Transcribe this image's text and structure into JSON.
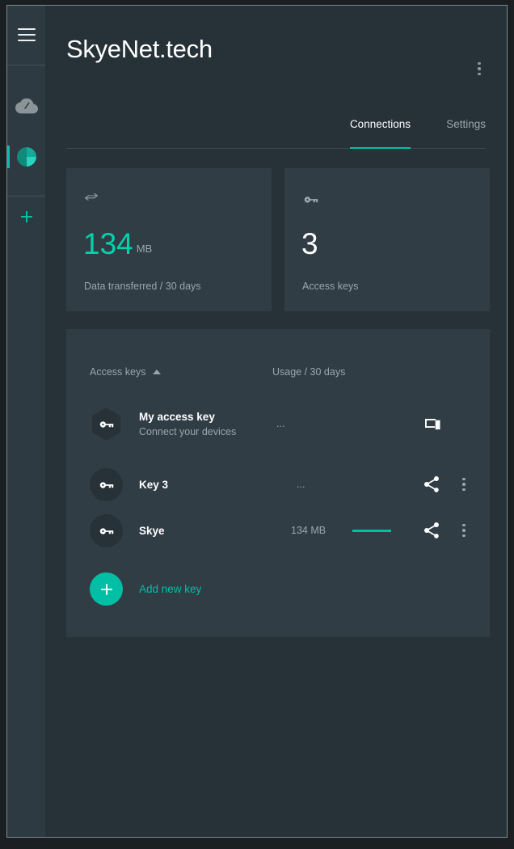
{
  "sidebar": {
    "menu_icon": "hamburger-menu-icon",
    "items": [
      {
        "icon": "cloud-slash-icon",
        "label": "",
        "selected": false,
        "color": "#8a9499"
      },
      {
        "icon": "teal-pie-circle-icon",
        "label": "",
        "selected": true,
        "color": "#00bfa5"
      },
      {
        "icon": "plus-icon",
        "label": "",
        "selected": false,
        "color": "#00bfa5"
      }
    ]
  },
  "header": {
    "title": "SkyeNet.tech",
    "overflow_menu_icon": "more-vert-icon"
  },
  "tabs": [
    {
      "label": "Connections",
      "active": true
    },
    {
      "label": "Settings",
      "active": false
    }
  ],
  "stats": [
    {
      "icon": "transfer-arrows-icon",
      "value": "134",
      "unit": "MB",
      "label": "Data transferred / 30 days",
      "value_color": "#00d3ac"
    },
    {
      "icon": "key-icon",
      "value": "3",
      "unit": "",
      "label": "Access keys",
      "value_color": "#ffffff"
    }
  ],
  "keys_panel": {
    "columns": {
      "name": "Access keys",
      "usage": "Usage / 30 days",
      "sort_icon": "sort-ascending-caret-icon"
    },
    "rows": [
      {
        "icon": "key-icon",
        "badge_shape": "hex",
        "name": "My access key",
        "subtitle": "Connect your devices",
        "usage": "...",
        "usage_bar_width": 0,
        "actions": [
          "devices-icon"
        ]
      },
      {
        "icon": "key-icon",
        "badge_shape": "circle",
        "name": "Key 3",
        "subtitle": "",
        "usage": "...",
        "usage_bar_width": 0,
        "actions": [
          "share-icon",
          "more-vert-icon"
        ]
      },
      {
        "icon": "key-icon",
        "badge_shape": "circle",
        "name": "Skye",
        "subtitle": "",
        "usage": "134 MB",
        "usage_bar_width": 48,
        "actions": [
          "share-icon",
          "more-vert-icon"
        ]
      }
    ],
    "add_new": {
      "icon": "plus-icon",
      "label": "Add new key"
    }
  },
  "colors": {
    "accent": "#00bfa5",
    "accent_bright": "#00d3ac",
    "page_bg": "#263238",
    "card_bg": "#313d45",
    "sidebar_bg": "#2e3a41",
    "muted_text": "#9aa6ad"
  }
}
